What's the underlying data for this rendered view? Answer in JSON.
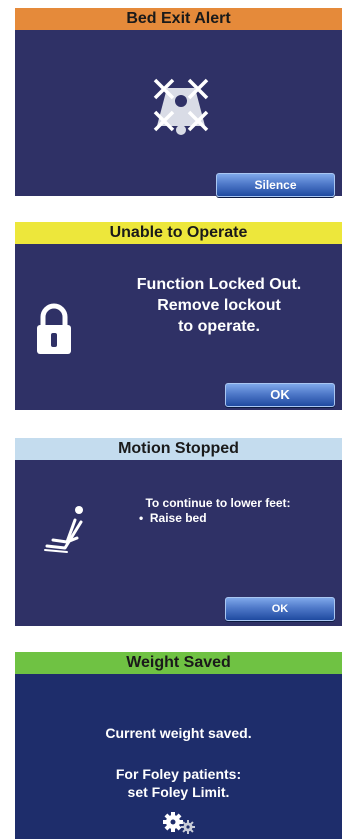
{
  "colors": {
    "panel_bg": "#2f3166",
    "panel_bg_dark": "#1e2d6b",
    "orange": "#e58a3a",
    "yellow": "#ede73b",
    "lightblue": "#c4dcee",
    "green": "#6fc243"
  },
  "alerts": [
    {
      "header": "Bed Exit Alert",
      "header_color": "#e58a3a",
      "icon": "bed-exit-icon",
      "button": "Silence"
    },
    {
      "header": "Unable to Operate",
      "header_color": "#ede73b",
      "icon": "lock-icon",
      "message_lines": [
        "Function Locked Out.",
        "Remove lockout",
        "to operate."
      ],
      "button": "OK"
    },
    {
      "header": "Motion Stopped",
      "header_color": "#c4dcee",
      "icon": "recline-chair-icon",
      "message": "To continue to lower feet:",
      "bullet": "Raise bed",
      "button": "OK"
    },
    {
      "header": "Weight Saved",
      "header_color": "#6fc243",
      "icon": "gears-icon",
      "message": "Current weight saved.",
      "note_lines": [
        "For Foley patients:",
        "set Foley Limit."
      ]
    }
  ]
}
